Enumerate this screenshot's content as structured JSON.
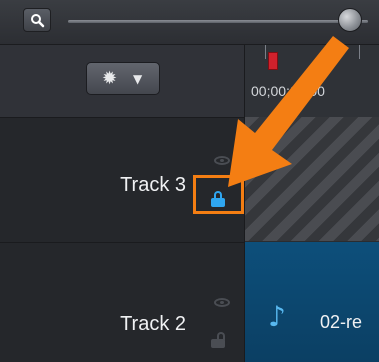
{
  "toolbar": {
    "zoom_icon": "magnifier-icon",
    "slider_level": 0.9
  },
  "header": {
    "settings_icon": "gear-icon",
    "settings_caret_icon": "caret-down-icon",
    "timecode": "00;00;00;00"
  },
  "tracks": [
    {
      "label": "Track 3",
      "visibility_icon": "eye-icon",
      "lock_icon": "lock-icon",
      "locked": true
    },
    {
      "label": "Track 2",
      "visibility_icon": "eye-icon",
      "lock_icon": "lock-icon",
      "locked": false
    }
  ],
  "clips": {
    "track2_clip_name": "02-re",
    "track2_clip_icon": "music-note-icon"
  },
  "annotation": {
    "color": "#f47e13",
    "target": "track-3-lock"
  },
  "colors": {
    "lock_active": "#2fa6f0",
    "playhead": "#d0212c",
    "audio_clip": "#0d4f7b"
  }
}
